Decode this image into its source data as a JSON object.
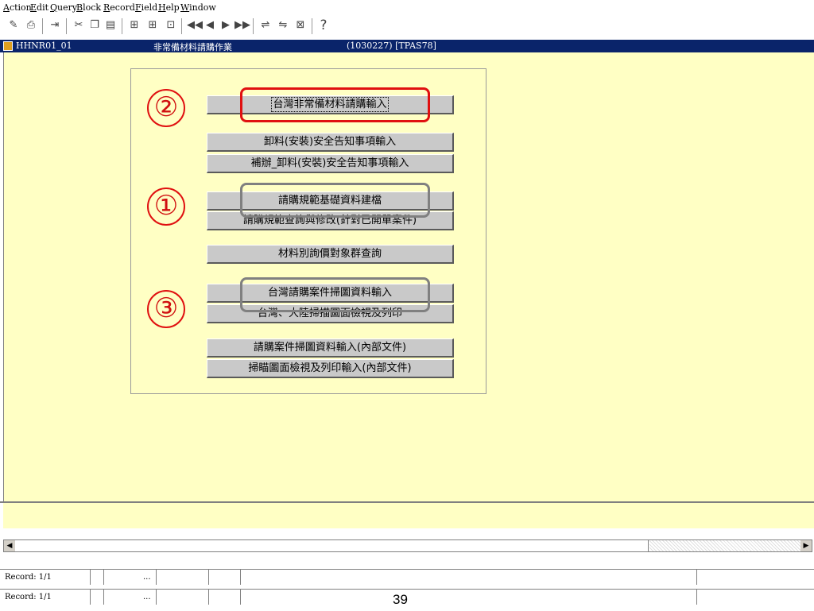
{
  "menu": [
    "Action",
    "Edit",
    "Query",
    "Block",
    "Record",
    "Field",
    "Help",
    "Window"
  ],
  "toolbar": {
    "icons": [
      "save-icon",
      "print-icon",
      "exit-icon",
      "cut-icon",
      "copy-icon",
      "paste-icon",
      "enter-query-icon",
      "execute-query-icon",
      "cancel-query-icon",
      "first-record-icon",
      "previous-record-icon",
      "next-record-icon",
      "last-record-icon",
      "insert-record-icon",
      "delete-record-icon",
      "lock-record-icon",
      "help-icon"
    ],
    "help_glyph": "?"
  },
  "title_bar": {
    "form_id": "HHNR01_01",
    "form_title": "非常備材料請購作業",
    "user_info": "(1030227) [TPAS78]"
  },
  "buttons": [
    {
      "label": "台灣非常備材料請購輸入"
    },
    {
      "label": "卸料(安裝)安全告知事項輸入"
    },
    {
      "label": "補辦_卸料(安裝)安全告知事項輸入"
    },
    {
      "label": "請購規範基礎資料建檔"
    },
    {
      "label": "請購規範查詢與修改(針對已開單案件)"
    },
    {
      "label": "材料別詢價對象群查詢"
    },
    {
      "label": "台灣請購案件掃圖資料輸入"
    },
    {
      "label": "台灣、大陸掃描圖面檢視及列印"
    },
    {
      "label": "請購案件掃圖資料輸入(內部文件)"
    },
    {
      "label": "掃瞄圖面檢視及列印輸入(內部文件)"
    }
  ],
  "annotations": [
    {
      "number": "②",
      "color": "#e01010"
    },
    {
      "number": "①",
      "color": "#808080"
    },
    {
      "number": "③",
      "color": "#808080"
    }
  ],
  "status": [
    {
      "record": "Record: 1/1",
      "count": "..."
    },
    {
      "record": "Record: 1/1",
      "count": "..."
    }
  ],
  "page_number": "39"
}
